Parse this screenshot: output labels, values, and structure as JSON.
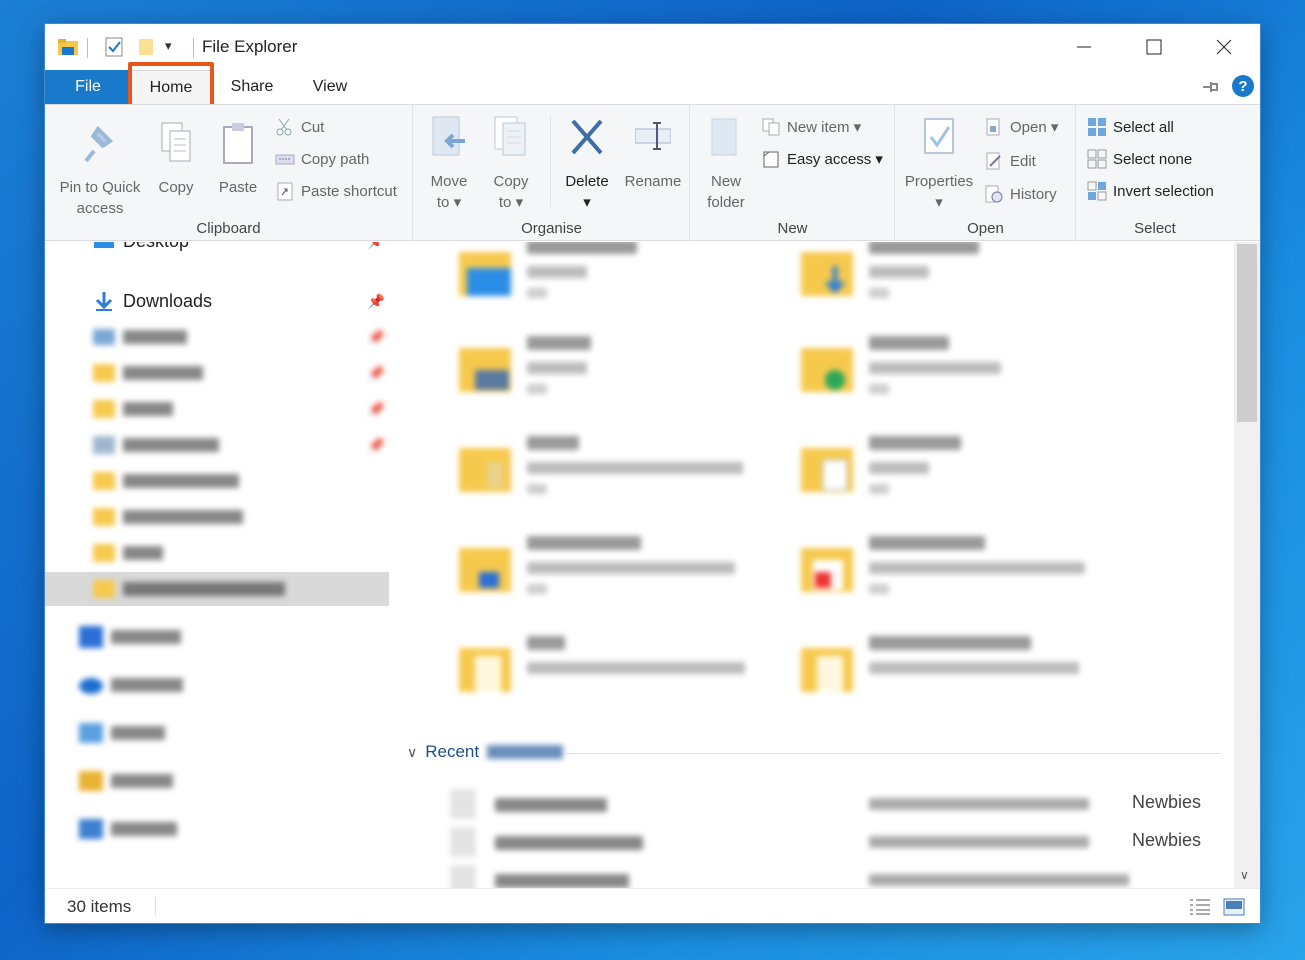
{
  "window": {
    "title": "File Explorer"
  },
  "tabs": {
    "file": "File",
    "home": "Home",
    "share": "Share",
    "view": "View"
  },
  "ribbon": {
    "clipboard": {
      "label": "Clipboard",
      "pin_line1": "Pin to Quick",
      "pin_line2": "access",
      "copy": "Copy",
      "paste": "Paste",
      "cut": "Cut",
      "copy_path": "Copy path",
      "paste_shortcut": "Paste shortcut"
    },
    "organise": {
      "label": "Organise",
      "move_line1": "Move",
      "move_line2": "to ▾",
      "copy_line1": "Copy",
      "copy_line2": "to ▾",
      "delete_line1": "Delete",
      "delete_line2": "▾",
      "rename": "Rename"
    },
    "new": {
      "label": "New",
      "new_folder_line1": "New",
      "new_folder_line2": "folder",
      "new_item": "New item ▾",
      "easy_access": "Easy access ▾"
    },
    "open": {
      "label": "Open",
      "properties_line1": "Properties",
      "properties_line2": "▾",
      "open": "Open ▾",
      "edit": "Edit",
      "history": "History"
    },
    "select": {
      "label": "Select",
      "select_all": "Select all",
      "select_none": "Select none",
      "invert_selection": "Invert selection"
    }
  },
  "nav": {
    "desktop": "Desktop",
    "downloads": "Downloads"
  },
  "content": {
    "recent_prefix": "Recent",
    "recent_tail_1": "Newbies",
    "recent_tail_2": "Newbies"
  },
  "status": {
    "count": "30 items"
  },
  "colors": {
    "accent": "#1979ca",
    "highlight": "#e8561c",
    "folder": "#f6c94d"
  }
}
